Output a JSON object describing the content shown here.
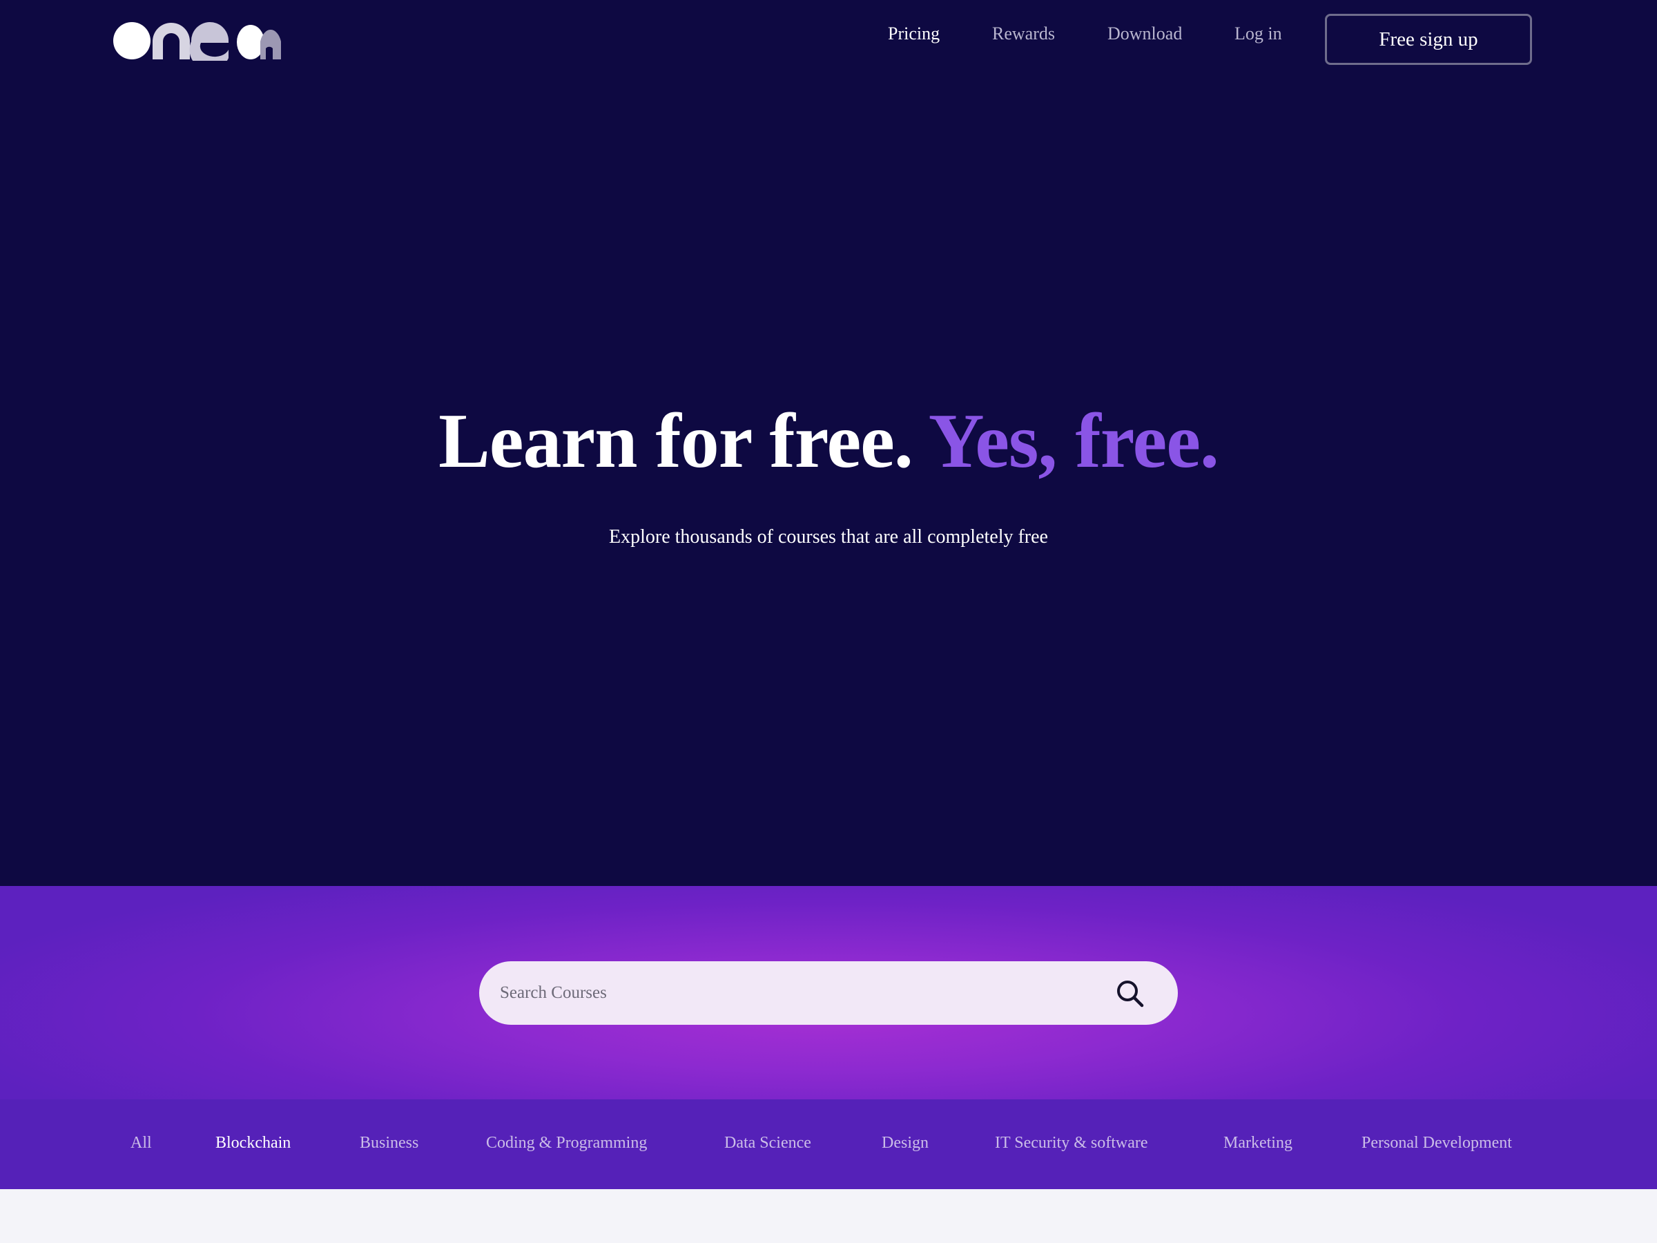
{
  "brand": {
    "logo_text": "one a",
    "logo_icon": "onea-logo"
  },
  "nav": {
    "items": [
      {
        "label": "Pricing",
        "active": true
      },
      {
        "label": "Rewards",
        "active": false
      },
      {
        "label": "Download",
        "active": false
      },
      {
        "label": "Log in",
        "active": false
      }
    ],
    "signup_label": "Free sign up"
  },
  "hero": {
    "headline": "Learn for free.",
    "headline_accent": "Yes, free.",
    "subheadline": "Explore thousands of courses that are all completely free"
  },
  "search": {
    "placeholder": "Search Courses",
    "value": "",
    "icon": "search-icon"
  },
  "categories": {
    "items": [
      {
        "label": "All",
        "active": false
      },
      {
        "label": "Blockchain",
        "active": true
      },
      {
        "label": "Business",
        "active": false
      },
      {
        "label": "Coding & Programming",
        "active": false
      },
      {
        "label": "Data Science",
        "active": false
      },
      {
        "label": "Design",
        "active": false
      },
      {
        "label": "IT Security & software",
        "active": false
      },
      {
        "label": "Marketing",
        "active": false
      },
      {
        "label": "Personal Development",
        "active": false
      }
    ]
  },
  "colors": {
    "hero_bg": "#0e0942",
    "accent": "#8a55e6",
    "search_band": "#8d2ad0",
    "category_band": "#5521b8",
    "page_bg": "#f4f4f9"
  }
}
